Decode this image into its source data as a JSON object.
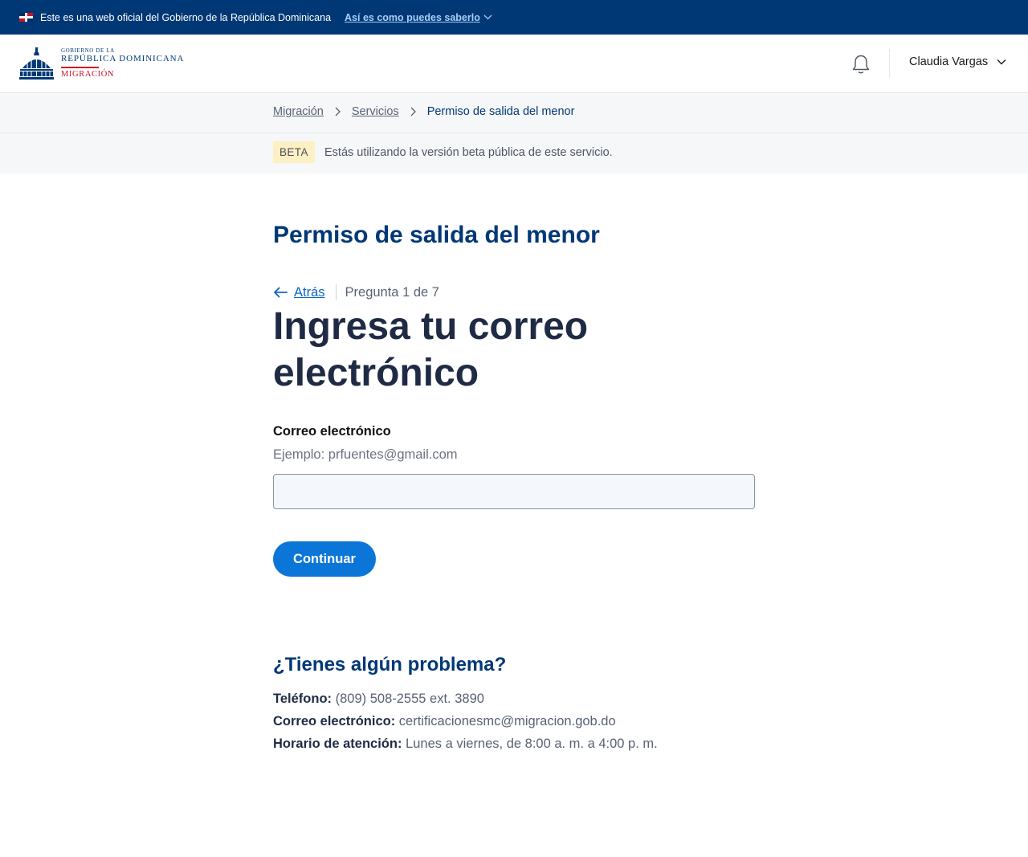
{
  "gov_banner": {
    "text": "Este es una web oficial del Gobierno de la República Dominicana",
    "link": "Así es como puedes saberlo"
  },
  "header": {
    "logo": {
      "small": "GOBIERNO DE LA",
      "main": "REPÚBLICA DOMINICANA",
      "sub": "MIGRACIÓN"
    },
    "user_name": "Claudia Vargas"
  },
  "breadcrumb": {
    "items": [
      "Migración",
      "Servicios"
    ],
    "current": "Permiso de salida del menor"
  },
  "beta": {
    "badge": "BETA",
    "text": "Estás utilizando la versión beta pública de este servicio."
  },
  "main": {
    "service_title": "Permiso de salida del menor",
    "back_label": "Atrás",
    "step": "Pregunta 1 de 7",
    "question": "Ingresa tu correo electrónico",
    "field_label": "Correo electrónico",
    "field_hint": "Ejemplo: prfuentes@gmail.com",
    "field_value": "",
    "continue_label": "Continuar"
  },
  "help": {
    "title": "¿Tienes algún problema?",
    "phone_label": "Teléfono:",
    "phone_value": "(809) 508-2555 ext. 3890",
    "email_label": "Correo electrónico:",
    "email_value": "certificacionesmc@migracion.gob.do",
    "hours_label": "Horario de atención:",
    "hours_value": "Lunes a viernes, de 8:00 a. m. a 4:00 p. m."
  },
  "colors": {
    "navy": "#003876",
    "primary_blue": "#0b76d8",
    "link_blue": "#0866c6",
    "red": "#ce1126",
    "beta_yellow": "#fdf0c3"
  },
  "icons": [
    "dr-flag-icon",
    "chevron-down-icon",
    "dome-logo-icon",
    "bell-icon",
    "chevron-right-icon",
    "arrow-left-icon"
  ]
}
